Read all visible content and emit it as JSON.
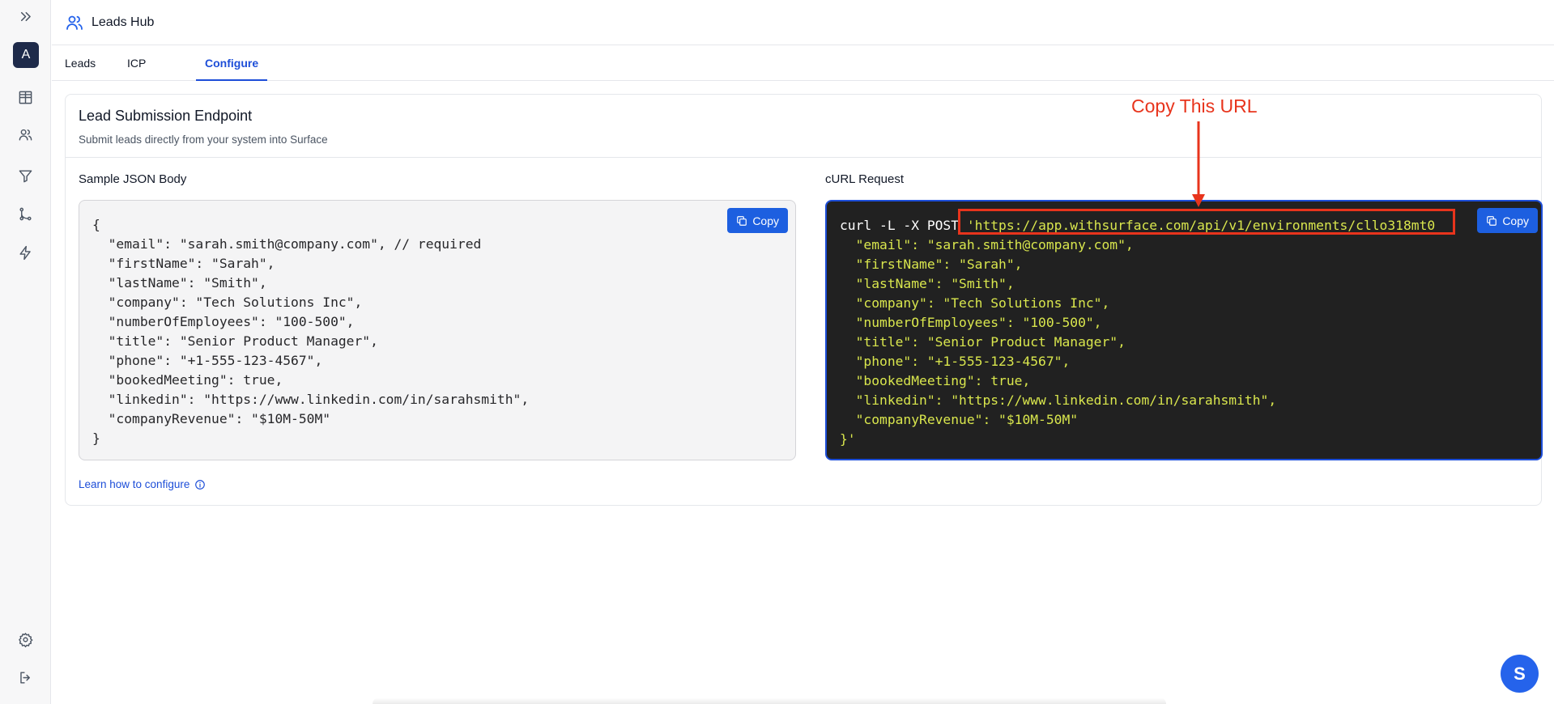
{
  "app": {
    "title": "Leads Hub"
  },
  "sidebar": {
    "avatar_letter": "A"
  },
  "tabs": [
    {
      "label": "Leads",
      "active": false
    },
    {
      "label": "ICP",
      "active": false
    },
    {
      "label": "Configure",
      "active": true
    }
  ],
  "card": {
    "title": "Lead Submission Endpoint",
    "subtitle": "Submit leads directly from your system into Surface"
  },
  "json_panel": {
    "label": "Sample JSON Body",
    "copy_label": "Copy",
    "code": "{\n  \"email\": \"sarah.smith@company.com\", // required\n  \"firstName\": \"Sarah\",\n  \"lastName\": \"Smith\",\n  \"company\": \"Tech Solutions Inc\",\n  \"numberOfEmployees\": \"100-500\",\n  \"title\": \"Senior Product Manager\",\n  \"phone\": \"+1-555-123-4567\",\n  \"bookedMeeting\": true,\n  \"linkedin\": \"https://www.linkedin.com/in/sarahsmith\",\n  \"companyRevenue\": \"$10M-50M\"\n}"
  },
  "curl_panel": {
    "label": "cURL Request",
    "copy_label": "Copy",
    "command": "curl -L -X POST ",
    "url": "'https://app.withsurface.com/api/v1/environments/cllo318mt0",
    "code": "  \"email\": \"sarah.smith@company.com\",\n  \"firstName\": \"Sarah\",\n  \"lastName\": \"Smith\",\n  \"company\": \"Tech Solutions Inc\",\n  \"numberOfEmployees\": \"100-500\",\n  \"title\": \"Senior Product Manager\",\n  \"phone\": \"+1-555-123-4567\",\n  \"bookedMeeting\": true,\n  \"linkedin\": \"https://www.linkedin.com/in/sarahsmith\",\n  \"companyRevenue\": \"$10M-50M\"\n}'"
  },
  "learn_link": "Learn how to configure",
  "annotation": {
    "text": "Copy This URL",
    "color": "#e8341c"
  },
  "chat_fab": {
    "letter": "S"
  },
  "colors": {
    "accent": "#1d4ed8",
    "code_bg": "#212121",
    "code_text": "#d9e64d"
  }
}
